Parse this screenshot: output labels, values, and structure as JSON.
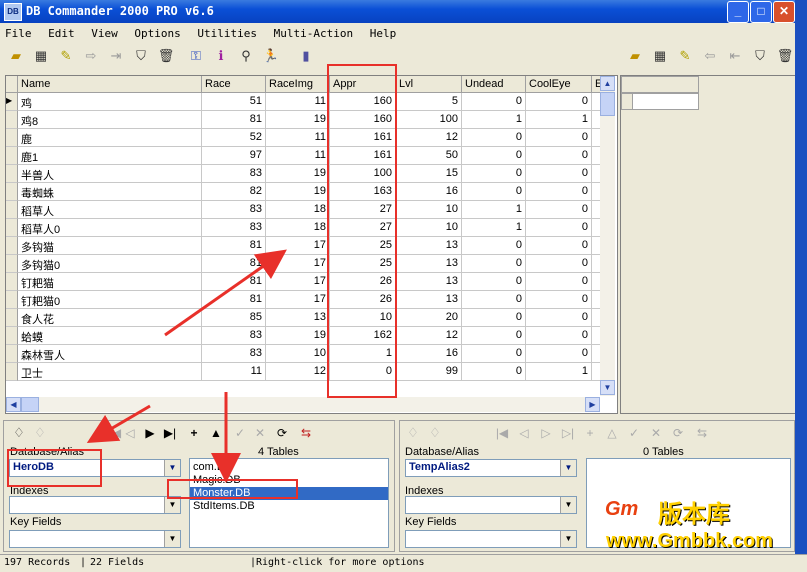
{
  "window": {
    "title": "DB Commander 2000 PRO v6.6",
    "icon_label": "DB"
  },
  "menu": [
    {
      "label": "File"
    },
    {
      "label": "Edit"
    },
    {
      "label": "View"
    },
    {
      "label": "Options"
    },
    {
      "label": "Utilities"
    },
    {
      "label": "Multi-Action"
    },
    {
      "label": "Help"
    }
  ],
  "grid": {
    "columns": [
      "Name",
      "Race",
      "RaceImg",
      "Appr",
      "Lvl",
      "Undead",
      "CoolEye",
      "E"
    ],
    "rows": [
      [
        "鸡",
        "51",
        "11",
        "160",
        "5",
        "0",
        "0"
      ],
      [
        "鸡8",
        "81",
        "19",
        "160",
        "100",
        "1",
        "1"
      ],
      [
        "鹿",
        "52",
        "11",
        "161",
        "12",
        "0",
        "0"
      ],
      [
        "鹿1",
        "97",
        "11",
        "161",
        "50",
        "0",
        "0"
      ],
      [
        "半兽人",
        "83",
        "19",
        "100",
        "15",
        "0",
        "0"
      ],
      [
        "毒蜘蛛",
        "82",
        "19",
        "163",
        "16",
        "0",
        "0"
      ],
      [
        "稻草人",
        "83",
        "18",
        "27",
        "10",
        "1",
        "0"
      ],
      [
        "稻草人0",
        "83",
        "18",
        "27",
        "10",
        "1",
        "0"
      ],
      [
        "多钩猫",
        "81",
        "17",
        "25",
        "13",
        "0",
        "0"
      ],
      [
        "多钩猫0",
        "81",
        "17",
        "25",
        "13",
        "0",
        "0"
      ],
      [
        "钉耙猫",
        "81",
        "17",
        "26",
        "13",
        "0",
        "0"
      ],
      [
        "钉耙猫0",
        "81",
        "17",
        "26",
        "13",
        "0",
        "0"
      ],
      [
        "食人花",
        "85",
        "13",
        "10",
        "20",
        "0",
        "0"
      ],
      [
        "蛤蟆",
        "83",
        "19",
        "162",
        "12",
        "0",
        "0"
      ],
      [
        "森林雪人",
        "83",
        "10",
        "1",
        "16",
        "0",
        "0"
      ],
      [
        "卫士",
        "11",
        "12",
        "0",
        "99",
        "0",
        "1"
      ]
    ]
  },
  "left_panel": {
    "database_label": "Database/Alias",
    "database_value": "HeroDB",
    "tables_count": "4 Tables",
    "indexes_label": "Indexes",
    "keyfields_label": "Key Fields",
    "tables": [
      "com.DB",
      "Magic.DB",
      "Monster.DB",
      "StdItems.DB"
    ],
    "selected_table": "Monster.DB"
  },
  "right_panel": {
    "database_label": "Database/Alias",
    "database_value": "TempAlias2",
    "tables_count": "0 Tables",
    "indexes_label": "Indexes",
    "keyfields_label": "Key Fields"
  },
  "status": {
    "records": "197 Records",
    "fields": "22 Fields",
    "hint": "Right-click for more options"
  },
  "watermark": {
    "brand": "版本库",
    "site": "www.Gmbbk.com"
  },
  "colors": {
    "title_blue": "#0A4FD6",
    "annotation_red": "#E8302A",
    "selection": "#316AC5"
  }
}
